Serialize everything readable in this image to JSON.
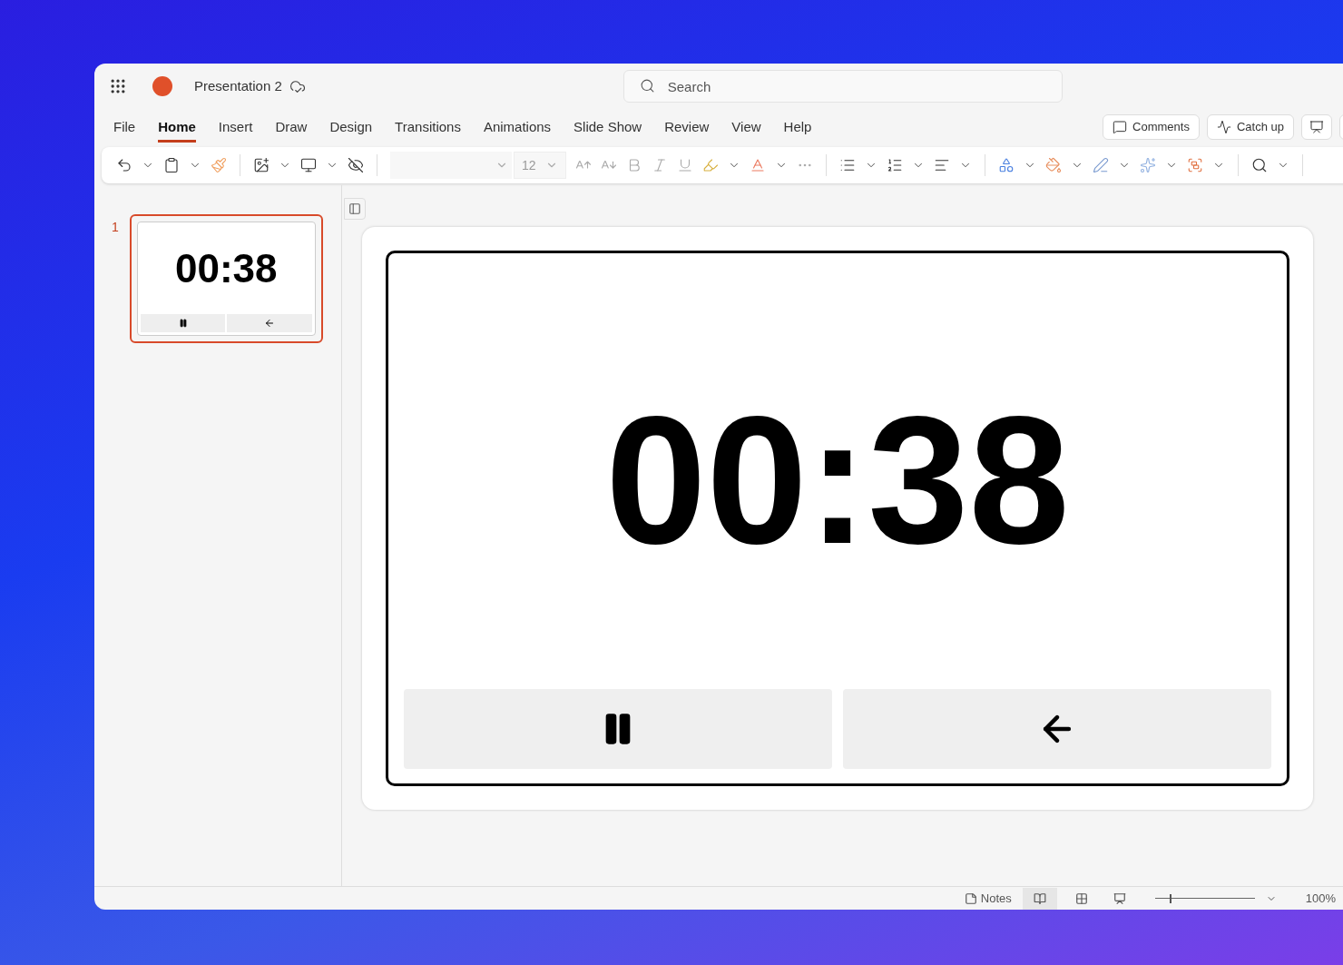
{
  "window": {
    "title": "Presentation 2"
  },
  "search": {
    "placeholder": "Search"
  },
  "menu": [
    {
      "label": "File",
      "selected": false
    },
    {
      "label": "Home",
      "selected": true
    },
    {
      "label": "Insert",
      "selected": false
    },
    {
      "label": "Draw",
      "selected": false
    },
    {
      "label": "Design",
      "selected": false
    },
    {
      "label": "Transitions",
      "selected": false
    },
    {
      "label": "Animations",
      "selected": false
    },
    {
      "label": "Slide Show",
      "selected": false
    },
    {
      "label": "Review",
      "selected": false
    },
    {
      "label": "View",
      "selected": false
    },
    {
      "label": "Help",
      "selected": false
    }
  ],
  "header_buttons": [
    "Comments",
    "Catch up"
  ],
  "toolbar": {
    "font_size": "12"
  },
  "thumbnails": [
    {
      "number": "1",
      "timer": "00:38",
      "selected": true
    }
  ],
  "slide": {
    "timer": "00:38"
  },
  "status_bar": {
    "notes": "Notes",
    "zoom_slider": {
      "level": 0.15
    },
    "zoom": "100%"
  }
}
